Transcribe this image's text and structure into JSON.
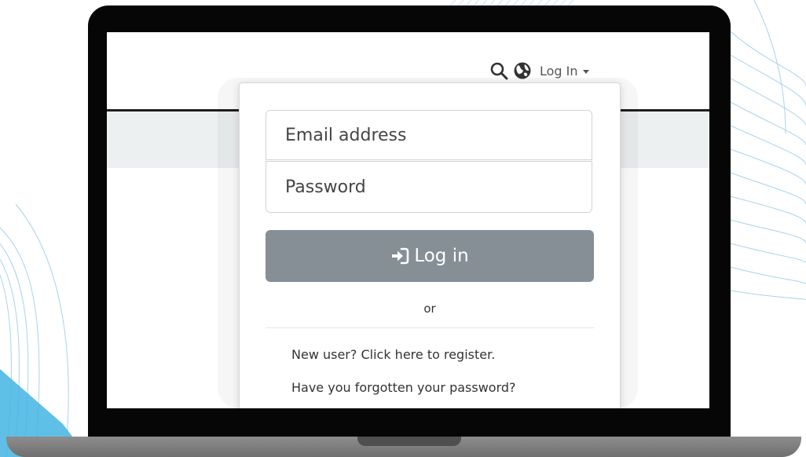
{
  "nav": {
    "login_toggle_label": "Log In",
    "icons": [
      "search-icon",
      "globe-icon",
      "caret-down-icon"
    ]
  },
  "login_form": {
    "email_placeholder": "Email address",
    "password_placeholder": "Password",
    "submit_label": "Log in",
    "submit_icon": "sign-in-icon",
    "separator_text": "or",
    "register_link": "New user? Click here to register.",
    "forgot_password_link": "Have you forgotten your password?"
  },
  "colors": {
    "button_gray": "#868e96",
    "deco_blue": "#9fcde6",
    "deco_left_blue": "#43b4e3",
    "band_gray": "#edf0f1"
  }
}
